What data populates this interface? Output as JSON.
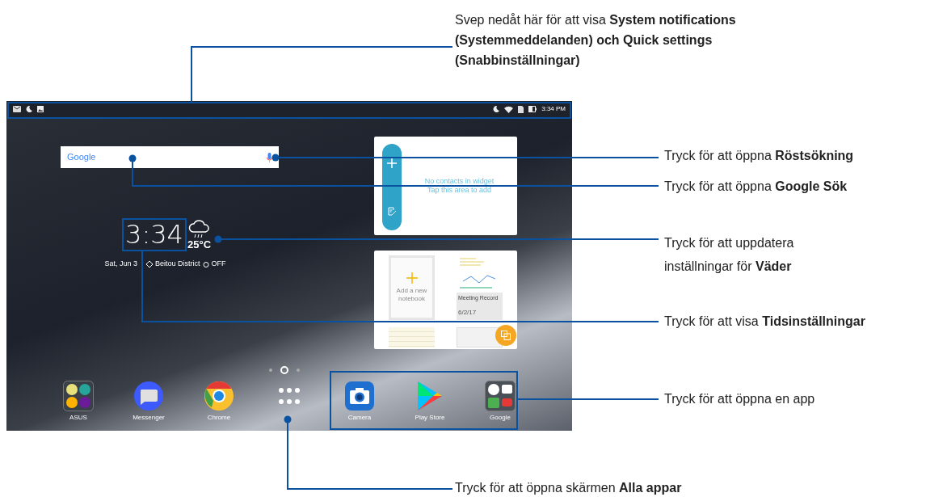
{
  "top_callout": "Svep nedåt här för att visa **System notifications (Systemmeddelanden) och Quick settings (Snabbinställningar)**",
  "status_bar": {
    "time": "3:34 PM"
  },
  "search_bar": {
    "logo": "Google"
  },
  "contacts_widget": {
    "lines": [
      "No contacts in widget",
      "Tap this area to add"
    ]
  },
  "clock_widget": {
    "time": "3:34",
    "temperature": "25°C",
    "date": "Sat, Jun 3",
    "location": "Beitou District",
    "alarm": "OFF"
  },
  "notes_widget": {
    "add_label": "Add a new notebook",
    "note_title": "Meeting Record",
    "note_date": "6/2/17"
  },
  "page_dots": [
    {
      "selected": false
    },
    {
      "selected": true
    },
    {
      "selected": false
    }
  ],
  "dock": [
    {
      "kind": "folder",
      "label": "ASUS"
    },
    {
      "kind": "messenger",
      "label": "Messenger"
    },
    {
      "kind": "chrome",
      "label": "Chrome"
    },
    {
      "kind": "all_apps"
    },
    {
      "kind": "camera",
      "label": "Camera"
    },
    {
      "kind": "play",
      "label": "Play Store"
    },
    {
      "kind": "google_folder",
      "label": "Google"
    }
  ],
  "right_callouts": [
    "Tryck för att öppna **Röstsökning**",
    "Tryck för att öppna **Google Sök**",
    "Tryck för att uppdatera inställningar för **Väder**",
    "Tryck för att visa **Tidsinställningar**",
    "Tryck för att öppna en app"
  ],
  "bottom_callout": "Tryck för att öppna skärmen **Alla appar**"
}
